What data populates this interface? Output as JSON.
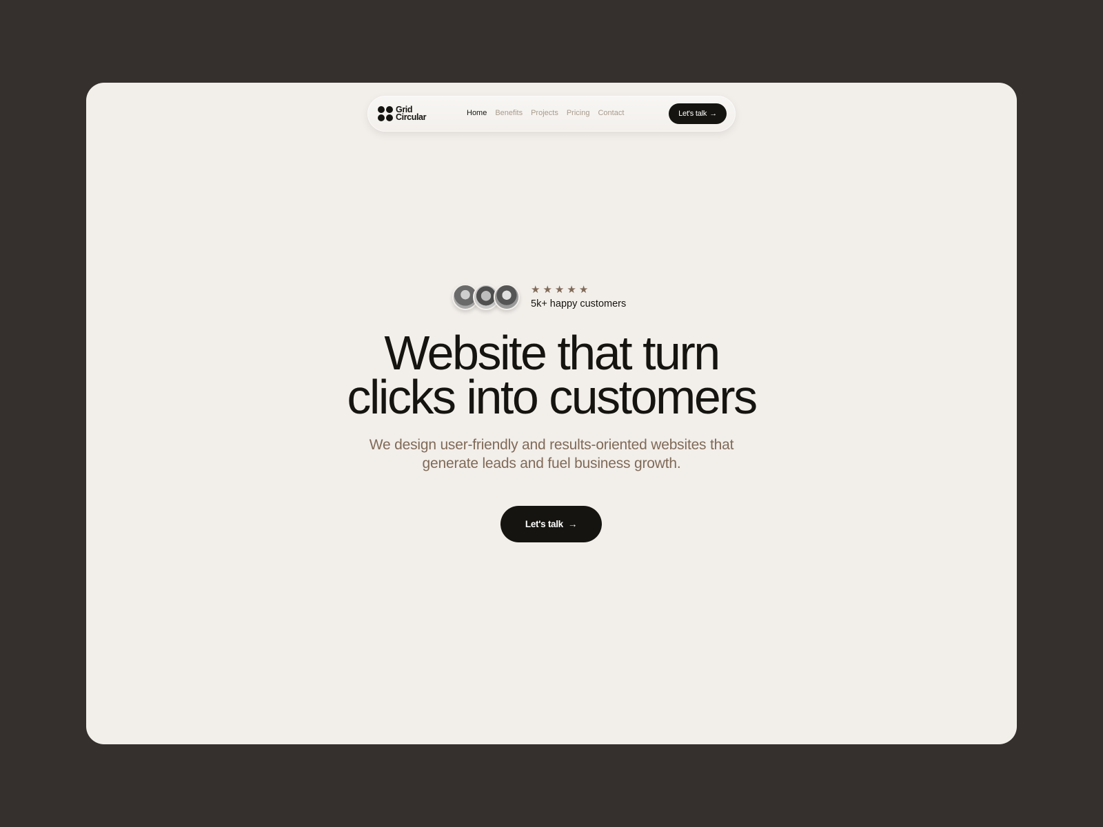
{
  "nav": {
    "logo_line1": "Grid",
    "logo_line2": "Circular",
    "links": [
      {
        "label": "Home",
        "active": true
      },
      {
        "label": "Benefits",
        "active": false
      },
      {
        "label": "Projects",
        "active": false
      },
      {
        "label": "Pricing",
        "active": false
      },
      {
        "label": "Contact",
        "active": false
      }
    ],
    "cta_label": "Let's talk",
    "cta_icon": "→"
  },
  "hero": {
    "avatars": [
      "customer-avatar-1",
      "customer-avatar-2",
      "customer-avatar-3"
    ],
    "rating_stars": 5,
    "star_glyph": "★",
    "customers_text": "5k+ happy customers",
    "headline_line1": "Website that turn",
    "headline_line2": "clicks into customers",
    "subtitle_line1": "We design user-friendly and results-oriented websites that",
    "subtitle_line2": "generate leads and fuel business growth.",
    "cta_label": "Let's talk",
    "cta_icon": "→"
  },
  "colors": {
    "page_bg": "#35302d",
    "card_bg": "#f2eeea",
    "primary": "#161410",
    "accent": "#806a58",
    "nav_inactive": "#a89a8c"
  }
}
